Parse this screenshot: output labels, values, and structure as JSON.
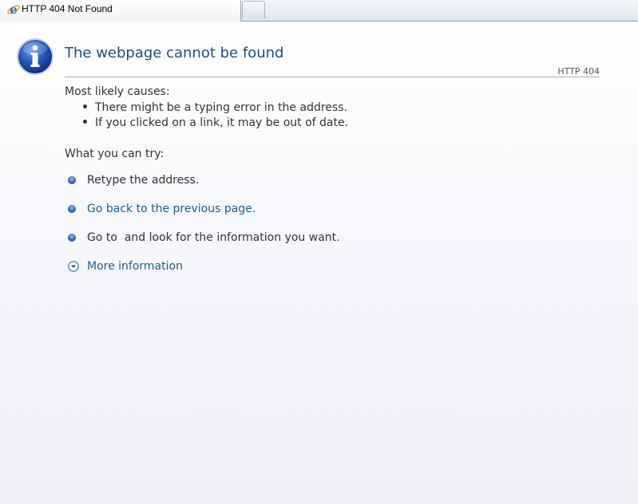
{
  "tab": {
    "title": "HTTP 404 Not Found",
    "icon": "internet-explorer-icon"
  },
  "page": {
    "title": "The webpage cannot be found",
    "http_code": "HTTP 404",
    "causes_heading": "Most likely causes:",
    "causes": [
      "There might be a typing error in the address.",
      "If you clicked on a link, it may be out of date."
    ],
    "try_heading": "What you can try:",
    "try_items": [
      {
        "text": "Retype the address.",
        "is_link": false
      },
      {
        "text": "Go back to the previous page.",
        "is_link": true
      },
      {
        "text": "Go to  and look for the information you want.",
        "is_link": false
      }
    ],
    "more_info": "More information",
    "more_info_icon": "chevron-down-circle-icon",
    "info_icon": "info-icon"
  },
  "colors": {
    "title": "#1f4d84",
    "link": "#1f5d87",
    "text": "#333333"
  }
}
